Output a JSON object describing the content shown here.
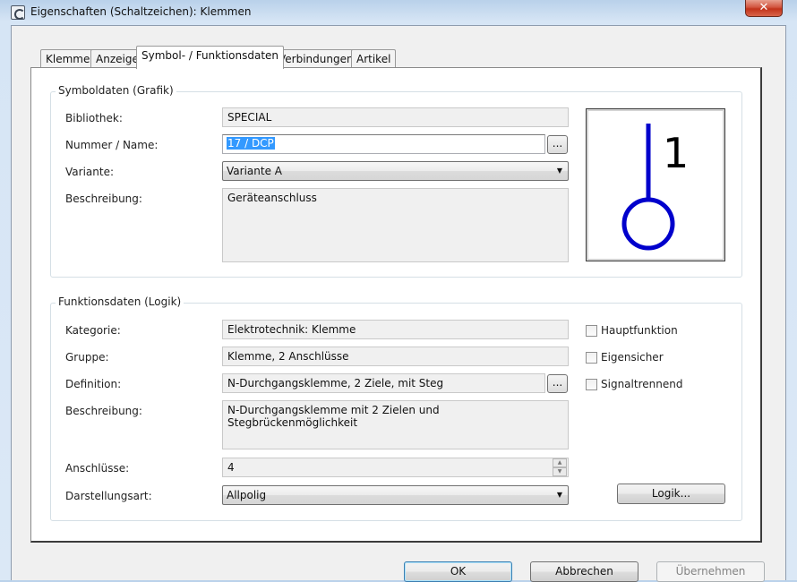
{
  "window": {
    "title": "Eigenschaften (Schaltzeichen): Klemmen",
    "close_label": "✕"
  },
  "tabs": [
    {
      "label": "Klemme"
    },
    {
      "label": "Anzeige"
    },
    {
      "label": "Symbol- / Funktionsdaten"
    },
    {
      "label": "Verbindungen"
    },
    {
      "label": "Artikel"
    }
  ],
  "active_tab": "Symbol- / Funktionsdaten",
  "symboldaten": {
    "group_label": "Symboldaten (Grafik)",
    "bibliothek_label": "Bibliothek:",
    "bibliothek_value": "SPECIAL",
    "nummer_label": "Nummer / Name:",
    "nummer_value": "17 / DCP",
    "browse_label": "...",
    "variante_label": "Variante:",
    "variante_value": "Variante A",
    "beschreibung_label": "Beschreibung:",
    "beschreibung_value": "Geräteanschluss",
    "preview_number": "1"
  },
  "funktionsdaten": {
    "group_label": "Funktionsdaten (Logik)",
    "kategorie_label": "Kategorie:",
    "kategorie_value": "Elektrotechnik: Klemme",
    "gruppe_label": "Gruppe:",
    "gruppe_value": "Klemme, 2 Anschlüsse",
    "definition_label": "Definition:",
    "definition_value": "N-Durchgangsklemme, 2 Ziele, mit Steg",
    "browse_label": "...",
    "beschreibung_label": "Beschreibung:",
    "beschreibung_value": "N-Durchgangsklemme mit 2 Zielen und Stegbrückenmöglichkeit",
    "anschluesse_label": "Anschlüsse:",
    "anschluesse_value": "4",
    "darstellungsart_label": "Darstellungsart:",
    "darstellungsart_value": "Allpolig",
    "checkboxes": [
      {
        "label": "Hauptfunktion",
        "checked": false
      },
      {
        "label": "Eigensicher",
        "checked": false
      },
      {
        "label": "Signaltrennend",
        "checked": false
      }
    ],
    "logik_button": "Logik..."
  },
  "footer": {
    "ok": "OK",
    "cancel": "Abbrechen",
    "apply": "Übernehmen"
  },
  "colors": {
    "selection": "#3399ff",
    "symbol_stroke": "#0000cc",
    "close_button": "#c2331b"
  }
}
